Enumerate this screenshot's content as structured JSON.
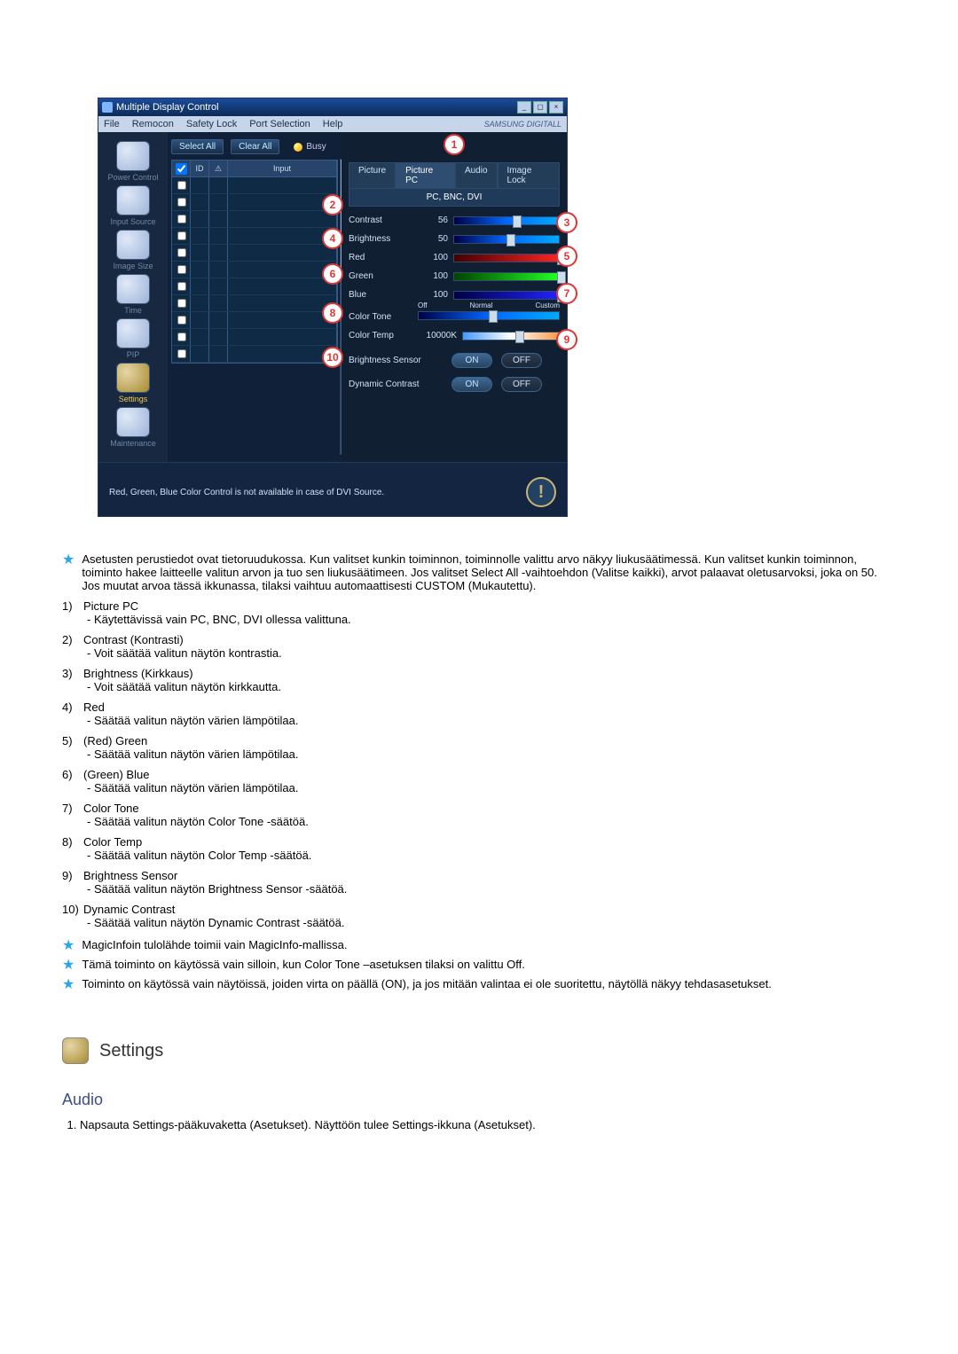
{
  "window": {
    "title": "Multiple Display Control",
    "brand": "SAMSUNG DIGITALL"
  },
  "menu": [
    "File",
    "Remocon",
    "Safety Lock",
    "Port Selection",
    "Help"
  ],
  "nav": [
    {
      "label": "Power Control"
    },
    {
      "label": "Input Source"
    },
    {
      "label": "Image Size"
    },
    {
      "label": "Time"
    },
    {
      "label": "PIP"
    },
    {
      "label": "Settings"
    },
    {
      "label": "Maintenance"
    }
  ],
  "center": {
    "select_all": "Select All",
    "clear_all": "Clear All",
    "busy": "Busy",
    "headers": {
      "check": "✓",
      "id": "ID",
      "warn": "⚠",
      "input": "Input"
    }
  },
  "right": {
    "tabs": [
      "Picture",
      "Picture PC",
      "Audio",
      "Image Lock"
    ],
    "active_tab": "Picture PC",
    "subheader": "PC, BNC, DVI",
    "rows": {
      "contrast": {
        "label": "Contrast",
        "value": "56"
      },
      "brightness": {
        "label": "Brightness",
        "value": "50"
      },
      "red": {
        "label": "Red",
        "value": "100"
      },
      "green": {
        "label": "Green",
        "value": "100"
      },
      "blue": {
        "label": "Blue",
        "value": "100"
      },
      "color_tone": {
        "label": "Color Tone",
        "opts": [
          "Off",
          "Normal",
          "Custom"
        ]
      },
      "color_temp": {
        "label": "Color Temp",
        "value": "10000K"
      },
      "brightness_sensor": {
        "label": "Brightness Sensor",
        "on": "ON",
        "off": "OFF"
      },
      "dynamic_contrast": {
        "label": "Dynamic Contrast",
        "on": "ON",
        "off": "OFF"
      }
    }
  },
  "footer_note": "Red, Green, Blue Color Control is not available in case of DVI Source.",
  "callouts": [
    "1",
    "2",
    "3",
    "4",
    "5",
    "6",
    "7",
    "8",
    "9",
    "10"
  ],
  "doc": {
    "star1": "Asetusten perustiedot ovat tietoruudukossa. Kun valitset kunkin toiminnon, toiminnolle valittu arvo näkyy liukusäätimessä. Kun valitset kunkin toiminnon, toiminto hakee laitteelle valitun arvon ja tuo sen liukusäätimeen. Jos valitset Select All -vaihtoehdon (Valitse kaikki), arvot palaavat oletusarvoksi, joka on 50. Jos muutat arvoa tässä ikkunassa, tilaksi vaihtuu automaattisesti CUSTOM (Mukautettu).",
    "items": [
      {
        "n": "1)",
        "t": "Picture PC",
        "d": "- Käytettävissä vain PC, BNC, DVI ollessa valittuna."
      },
      {
        "n": "2)",
        "t": "Contrast (Kontrasti)",
        "d": "- Voit säätää valitun näytön kontrastia."
      },
      {
        "n": "3)",
        "t": "Brightness (Kirkkaus)",
        "d": "- Voit säätää valitun näytön kirkkautta."
      },
      {
        "n": "4)",
        "t": "Red",
        "d": "- Säätää valitun näytön värien lämpötilaa."
      },
      {
        "n": "5)",
        "t": "(Red) Green",
        "d": "- Säätää valitun näytön värien lämpötilaa."
      },
      {
        "n": "6)",
        "t": "(Green) Blue",
        "d": "- Säätää valitun näytön värien lämpötilaa."
      },
      {
        "n": "7)",
        "t": "Color Tone",
        "d": "- Säätää valitun näytön Color Tone -säätöä."
      },
      {
        "n": "8)",
        "t": "Color Temp",
        "d": "- Säätää valitun näytön Color Temp -säätöä."
      },
      {
        "n": "9)",
        "t": "Brightness Sensor",
        "d": "- Säätää valitun näytön Brightness Sensor -säätöä."
      },
      {
        "n": "10)",
        "t": "Dynamic Contrast",
        "d": "- Säätää valitun näytön Dynamic Contrast -säätöä."
      }
    ],
    "star2": "MagicInfoin tulolähde toimii vain MagicInfo-mallissa.",
    "star3": "Tämä toiminto on käytössä vain silloin, kun Color Tone –asetuksen tilaksi on valittu Off.",
    "star4": "Toiminto on käytössä vain näytöissä, joiden virta on päällä (ON), ja jos mitään valintaa ei ole suoritettu, näytöllä näkyy tehdasasetukset.",
    "settings_heading": "Settings",
    "audio_heading": "Audio",
    "audio_step1": "Napsauta Settings-pääkuvaketta (Asetukset). Näyttöön tulee Settings-ikkuna (Asetukset)."
  }
}
